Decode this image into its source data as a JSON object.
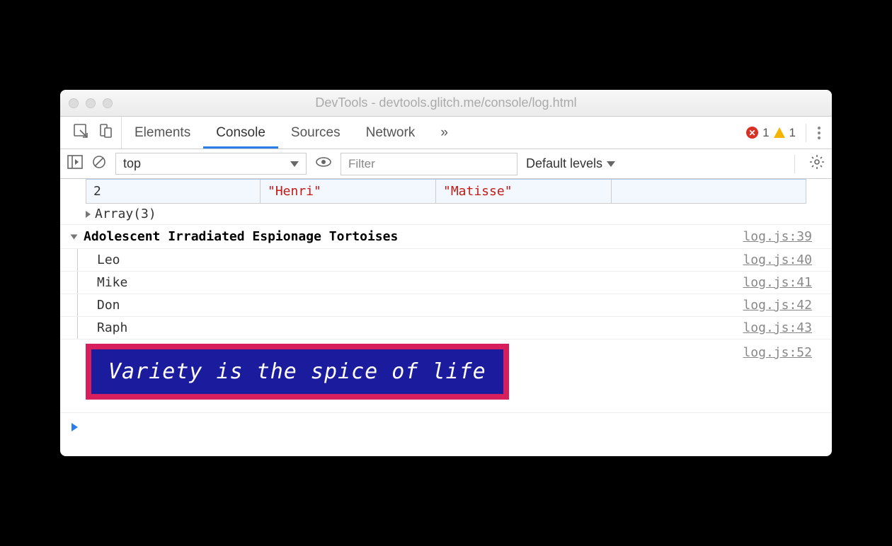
{
  "window": {
    "title": "DevTools - devtools.glitch.me/console/log.html"
  },
  "tabs": {
    "elements": "Elements",
    "console": "Console",
    "sources": "Sources",
    "network": "Network",
    "overflow": "»"
  },
  "status": {
    "errors": "1",
    "warnings": "1"
  },
  "toolbar": {
    "context": "top",
    "filter_placeholder": "Filter",
    "levels": "Default levels"
  },
  "table": {
    "index": "2",
    "first": "\"Henri\"",
    "last": "\"Matisse\""
  },
  "array_summary": "Array(3)",
  "group": {
    "header": "Adolescent Irradiated Espionage Tortoises",
    "header_src": "log.js:39",
    "items": [
      {
        "msg": "Leo",
        "src": "log.js:40"
      },
      {
        "msg": "Mike",
        "src": "log.js:41"
      },
      {
        "msg": "Don",
        "src": "log.js:42"
      },
      {
        "msg": "Raph",
        "src": "log.js:43"
      }
    ]
  },
  "styled": {
    "text": "Variety is the spice of life",
    "src": "log.js:52"
  },
  "prompt": "›"
}
